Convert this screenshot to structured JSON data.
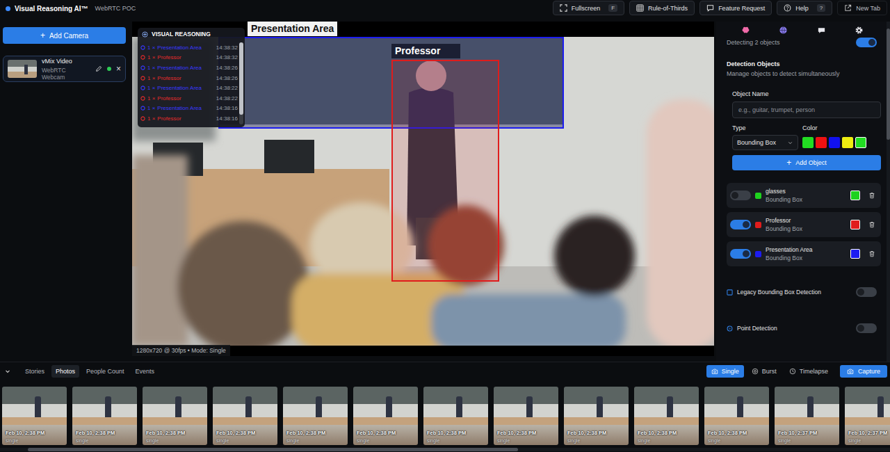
{
  "app": {
    "title": "Visual Reasoning AI™",
    "subtitle": "WebRTC POC"
  },
  "toolbar": [
    {
      "label": "Fullscreen",
      "key": "F"
    },
    {
      "label": "Rule-of-Thirds"
    },
    {
      "label": "Feature Request"
    },
    {
      "label": "Help",
      "key": "?"
    },
    {
      "label": "New Tab"
    }
  ],
  "sidebar": {
    "add_icon": "+",
    "add_button": "Add Camera",
    "cameras": [
      {
        "name": "vMix Video",
        "source": "WebRTC Webcam",
        "online": true,
        "close": "×",
        "selected": true
      }
    ]
  },
  "video": {
    "info": "1280x720 @ 30fps • Mode: Single",
    "detections": [
      {
        "label": "Presentation Area",
        "color": "#1c1cf0"
      },
      {
        "label": "Professor",
        "color": "#e01c1c"
      }
    ]
  },
  "reasoning": {
    "title": "VISUAL REASONING",
    "entries": [
      {
        "count": "1 ×",
        "label": "Presentation Area",
        "time": "14:38:32",
        "color": "#3838ff"
      },
      {
        "count": "1 ×",
        "label": "Professor",
        "time": "14:38:32",
        "color": "#e52b2b"
      },
      {
        "count": "1 ×",
        "label": "Presentation Area",
        "time": "14:38:26",
        "color": "#3838ff"
      },
      {
        "count": "1 ×",
        "label": "Professor",
        "time": "14:38:26",
        "color": "#e52b2b"
      },
      {
        "count": "1 ×",
        "label": "Presentation Area",
        "time": "14:38:22",
        "color": "#3838ff"
      },
      {
        "count": "1 ×",
        "label": "Professor",
        "time": "14:38:22",
        "color": "#e52b2b"
      },
      {
        "count": "1 ×",
        "label": "Presentation Area",
        "time": "14:38:16",
        "color": "#3838ff"
      },
      {
        "count": "1 ×",
        "label": "Professor",
        "time": "14:38:16",
        "color": "#e52b2b"
      }
    ]
  },
  "settings": {
    "tabs": [
      {
        "selected": true
      },
      {
        "selected": false
      },
      {
        "selected": false
      },
      {
        "selected": false
      }
    ],
    "status": "Detecting 2 objects",
    "status_on": true,
    "heading": "Detection Objects",
    "subheading": "Manage objects to detect simultaneously",
    "name_label": "Object Name",
    "name_placeholder": "e.g., guitar, trumpet, person",
    "type_label": "Type",
    "type_value": "Bounding Box",
    "color_label": "Color",
    "swatches": [
      {
        "color": "#22dd22",
        "selected": false
      },
      {
        "color": "#ee1111",
        "selected": false
      },
      {
        "color": "#1111ee",
        "selected": false
      },
      {
        "color": "#eeee11",
        "selected": false
      },
      {
        "color": "#22dd22",
        "selected": true
      }
    ],
    "add_icon": "+",
    "add_button": "Add Object",
    "objects": [
      {
        "name": "glasses",
        "type": "Bounding Box",
        "on": false,
        "color": "#1ed21e"
      },
      {
        "name": "Professor",
        "type": "Bounding Box",
        "on": true,
        "color": "#e01c1c"
      },
      {
        "name": "Presentation Area",
        "type": "Bounding Box",
        "on": true,
        "color": "#1c1cf0"
      }
    ],
    "options": [
      {
        "label": "Legacy Bounding Box Detection",
        "on": false,
        "kind": "checkbox"
      },
      {
        "label": "Point Detection",
        "on": false,
        "kind": "radio"
      }
    ]
  },
  "bottom": {
    "tabs": [
      {
        "label": "Stories",
        "selected": false
      },
      {
        "label": "Photos",
        "selected": true
      },
      {
        "label": "People Count",
        "selected": false
      },
      {
        "label": "Events",
        "selected": false
      }
    ],
    "modes": [
      {
        "label": "Single",
        "selected": true
      },
      {
        "label": "Burst",
        "selected": false
      },
      {
        "label": "Timelapse",
        "selected": false
      }
    ],
    "capture": "Capture",
    "photos": [
      {
        "time": "Feb 10, 2:38 PM",
        "mode": "single"
      },
      {
        "time": "Feb 10, 2:38 PM",
        "mode": "single"
      },
      {
        "time": "Feb 10, 2:38 PM",
        "mode": "single"
      },
      {
        "time": "Feb 10, 2:38 PM",
        "mode": "single"
      },
      {
        "time": "Feb 10, 2:38 PM",
        "mode": "single"
      },
      {
        "time": "Feb 10, 2:38 PM",
        "mode": "single"
      },
      {
        "time": "Feb 10, 2:38 PM",
        "mode": "single"
      },
      {
        "time": "Feb 10, 2:38 PM",
        "mode": "single"
      },
      {
        "time": "Feb 10, 2:38 PM",
        "mode": "single"
      },
      {
        "time": "Feb 10, 2:38 PM",
        "mode": "single"
      },
      {
        "time": "Feb 10, 2:38 PM",
        "mode": "single"
      },
      {
        "time": "Feb 10, 2:37 PM",
        "mode": "single"
      },
      {
        "time": "Feb 10, 2:37 PM",
        "mode": "single"
      }
    ]
  }
}
